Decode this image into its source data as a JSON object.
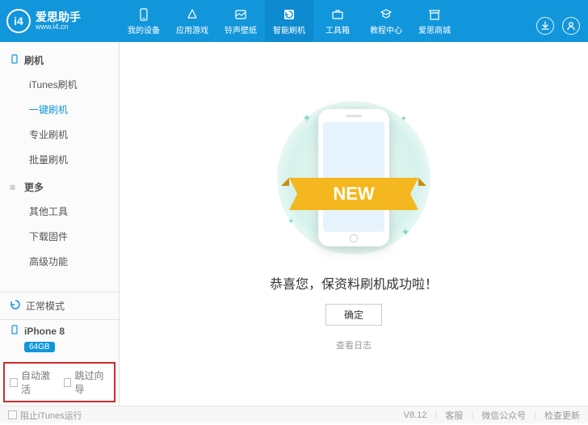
{
  "brand": {
    "name": "爱思助手",
    "url": "www.i4.cn",
    "logo_text": "i4"
  },
  "window_controls": [
    "menu",
    "skin",
    "min",
    "max",
    "close"
  ],
  "header_tabs": [
    {
      "icon": "phone",
      "label": "我的设备"
    },
    {
      "icon": "apps",
      "label": "应用游戏"
    },
    {
      "icon": "ringtone",
      "label": "铃声壁纸"
    },
    {
      "icon": "flash",
      "label": "智能刷机",
      "active": true
    },
    {
      "icon": "tools",
      "label": "工具箱"
    },
    {
      "icon": "tutorial",
      "label": "教程中心"
    },
    {
      "icon": "store",
      "label": "爱思商城"
    }
  ],
  "header_right": {
    "download_icon": "download",
    "user_icon": "user"
  },
  "sidebar": {
    "groups": [
      {
        "title": "刷机",
        "icon": "phone",
        "items": [
          {
            "label": "iTunes刷机"
          },
          {
            "label": "一键刷机",
            "active": true
          },
          {
            "label": "专业刷机"
          },
          {
            "label": "批量刷机"
          }
        ]
      },
      {
        "title": "更多",
        "icon": "more",
        "items": [
          {
            "label": "其他工具"
          },
          {
            "label": "下载固件"
          },
          {
            "label": "高级功能"
          }
        ]
      }
    ],
    "mode": {
      "icon": "refresh",
      "label": "正常模式"
    },
    "device": {
      "icon": "phone-small",
      "name": "iPhone 8",
      "storage": "64GB"
    },
    "options": [
      {
        "label": "自动激活",
        "checked": false
      },
      {
        "label": "跳过向导",
        "checked": false
      }
    ]
  },
  "main": {
    "new_tag": "NEW",
    "message": "恭喜您，保资料刷机成功啦！",
    "ok_button": "确定",
    "log_link": "查看日志"
  },
  "footer": {
    "block_itunes": "阻止iTunes运行",
    "version": "V8.12",
    "links": [
      "客服",
      "微信公众号",
      "检查更新"
    ]
  }
}
